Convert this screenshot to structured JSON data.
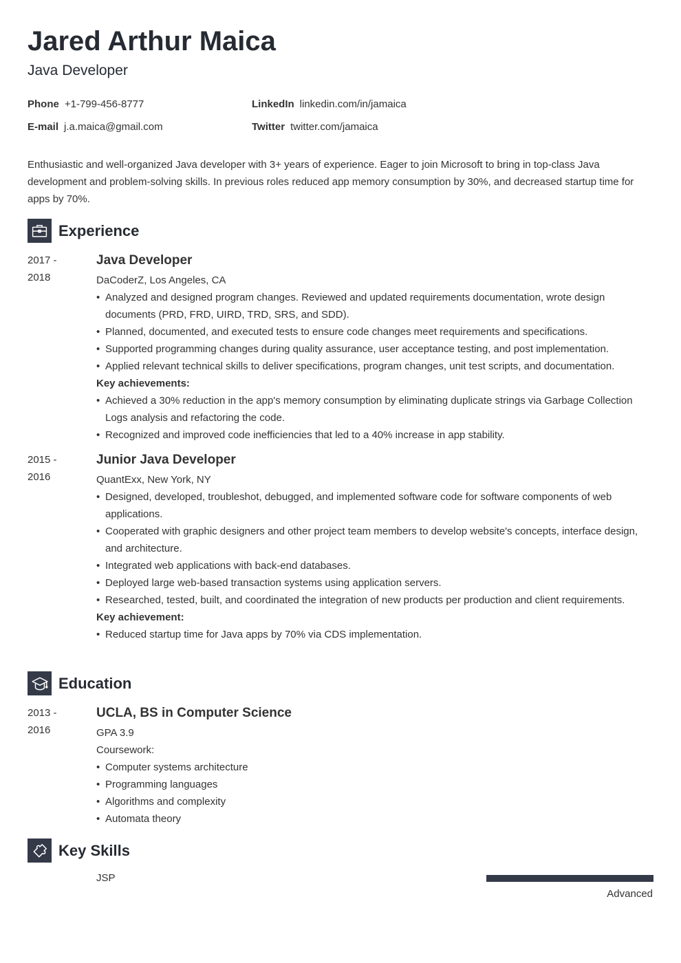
{
  "header": {
    "name": "Jared Arthur Maica",
    "title": "Java Developer"
  },
  "contact": [
    {
      "label": "Phone",
      "value": "+1-799-456-8777"
    },
    {
      "label": "LinkedIn",
      "value": "linkedin.com/in/jamaica"
    },
    {
      "label": "E-mail",
      "value": "j.a.maica@gmail.com"
    },
    {
      "label": "Twitter",
      "value": "twitter.com/jamaica"
    }
  ],
  "summary": "Enthusiastic and well-organized Java developer with 3+ years of experience. Eager to join Microsoft to bring in top-class Java development and problem-solving skills. In previous roles reduced app memory consumption by 30%, and decreased startup time for apps by 70%.",
  "sections": {
    "experience": {
      "title": "Experience",
      "icon": "briefcase-icon"
    },
    "education": {
      "title": "Education",
      "icon": "graduation-cap-icon"
    },
    "skills": {
      "title": "Key Skills",
      "icon": "puzzle-piece-icon"
    }
  },
  "experience": [
    {
      "date_start": "2017 -",
      "date_end": "2018",
      "role": "Java Developer",
      "company": "DaCoderZ, Los Angeles, CA",
      "bullets": [
        "Analyzed and designed program changes. Reviewed and updated requirements documentation, wrote design documents (PRD, FRD, UIRD, TRD, SRS, and SDD).",
        "Planned, documented, and executed tests to ensure code changes meet requirements and specifications.",
        "Supported programming changes during quality assurance, user acceptance testing, and post implementation.",
        "Applied relevant technical skills to deliver specifications, program changes, unit test scripts, and documentation."
      ],
      "achievements_label": "Key achievements:",
      "achievements": [
        "Achieved a 30% reduction in the app's memory consumption by eliminating duplicate strings via Garbage Collection Logs analysis and refactoring the code.",
        "Recognized and improved code inefficiencies that led to a 40% increase in app stability."
      ]
    },
    {
      "date_start": "2015 -",
      "date_end": "2016",
      "role": "Junior Java Developer",
      "company": "QuantExx, New York, NY",
      "bullets": [
        "Designed, developed, troubleshot, debugged, and implemented software code for software components of web applications.",
        "Cooperated with graphic designers and other project team members to develop website's concepts, interface design, and architecture.",
        "Integrated web applications with back-end databases.",
        "Deployed large web-based transaction systems using application servers.",
        "Researched, tested, built, and coordinated the integration of new products per production and client requirements."
      ],
      "achievements_label": "Key achievement:",
      "achievements": [
        "Reduced startup time for Java apps by 70% via CDS implementation."
      ]
    }
  ],
  "education": [
    {
      "date_start": "2013 -",
      "date_end": "2016",
      "degree": "UCLA, BS in Computer Science",
      "gpa": "GPA 3.9",
      "coursework_label": "Coursework:",
      "coursework": [
        "Computer systems architecture",
        "Programming languages",
        "Algorithms and complexity",
        "Automata theory"
      ]
    }
  ],
  "skills": [
    {
      "name": "JSP",
      "level": "Advanced",
      "level_fraction": 1.0
    }
  ]
}
